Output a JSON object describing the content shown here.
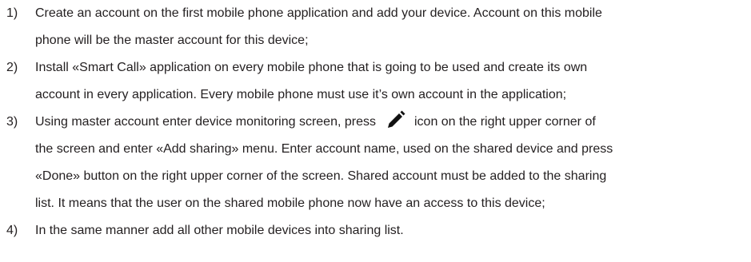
{
  "steps": [
    {
      "number": "1)",
      "lines": [
        "Create an account on the first mobile phone application and add your device. Account on this mobile",
        "phone will be the master account for this device;"
      ]
    },
    {
      "number": "2)",
      "lines": [
        "Install «Smart Call» application on every mobile phone that is going to be used and create its own",
        "account in every application. Every mobile phone must use it’s own account in the application;"
      ]
    },
    {
      "number": "3)",
      "line1_before_icon": "Using master account enter device monitoring screen, press",
      "icon": "edit-pencil-icon",
      "line1_after_icon": "icon on the right upper corner of",
      "lines": [
        "the screen and enter «Add sharing» menu. Enter account name, used on the shared device and press",
        "«Done» button on the right upper corner of the screen. Shared account must be added to the sharing",
        "list. It means that the user on the shared mobile phone now have an access to this device;"
      ]
    },
    {
      "number": "4)",
      "lines": [
        "In the same manner add all other mobile devices into sharing list."
      ]
    }
  ]
}
